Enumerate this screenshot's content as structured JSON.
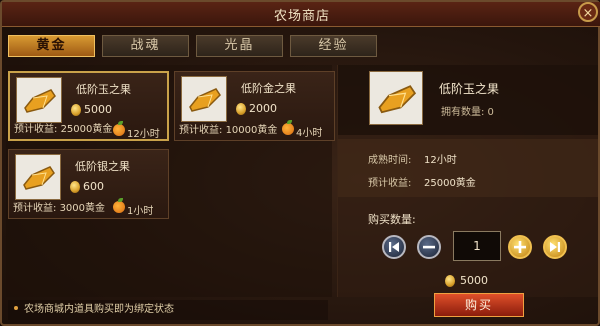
{
  "window": {
    "title": "农场商店",
    "close_label": "×"
  },
  "tabs": [
    "黄金",
    "战魂",
    "光晶",
    "经验"
  ],
  "active_tab": 0,
  "items": [
    {
      "name": "低阶玉之果",
      "price": "5000",
      "yield_label": "预计收益:",
      "yield": "25000黄金",
      "time": "12小时"
    },
    {
      "name": "低阶金之果",
      "price": "2000",
      "yield_label": "预计收益:",
      "yield": "10000黄金",
      "time": "4小时"
    },
    {
      "name": "低阶银之果",
      "price": "600",
      "yield_label": "预计收益:",
      "yield": "3000黄金",
      "time": "1小时"
    }
  ],
  "detail": {
    "name": "低阶玉之果",
    "owned": "拥有数量: 0",
    "mature_label": "成熟时间:",
    "mature_value": "12小时",
    "yield_label": "预计收益:",
    "yield_value": "25000黄金",
    "buy_qty_label": "购买数量:",
    "quantity": "1",
    "total": "5000",
    "buy_button": "购买"
  },
  "notice": "农场商城内道具购买即为绑定状态",
  "colors": {
    "gold": "#d89a32",
    "buy_red": "#c83a1c"
  }
}
